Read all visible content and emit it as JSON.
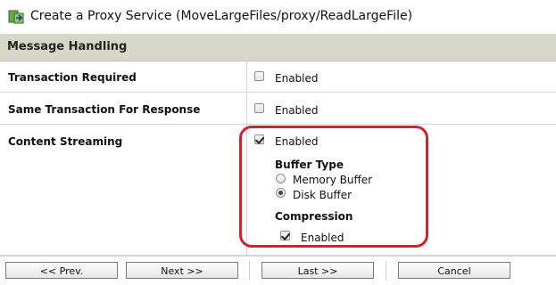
{
  "header": {
    "title": "Create a Proxy Service (MoveLargeFiles/proxy/ReadLargeFile)",
    "icon": "proxy-service-icon"
  },
  "section": {
    "title": "Message Handling"
  },
  "rows": {
    "transaction_required": {
      "label": "Transaction Required",
      "option_label": "Enabled",
      "checked": false
    },
    "same_transaction": {
      "label": "Same Transaction For Response",
      "option_label": "Enabled",
      "checked": false
    },
    "content_streaming": {
      "label": "Content Streaming",
      "option_label": "Enabled",
      "checked": true,
      "buffer_type": {
        "heading": "Buffer Type",
        "options": [
          {
            "label": "Memory Buffer",
            "selected": false
          },
          {
            "label": "Disk Buffer",
            "selected": true
          }
        ]
      },
      "compression": {
        "heading": "Compression",
        "option_label": "Enabled",
        "checked": true
      }
    }
  },
  "footer": {
    "prev_label": "<< Prev.",
    "next_label": "Next >>",
    "last_label": "Last >>",
    "cancel_label": "Cancel"
  },
  "colors": {
    "section_header_bg": "#d8d8c8",
    "highlight_border": "#d9202a"
  }
}
